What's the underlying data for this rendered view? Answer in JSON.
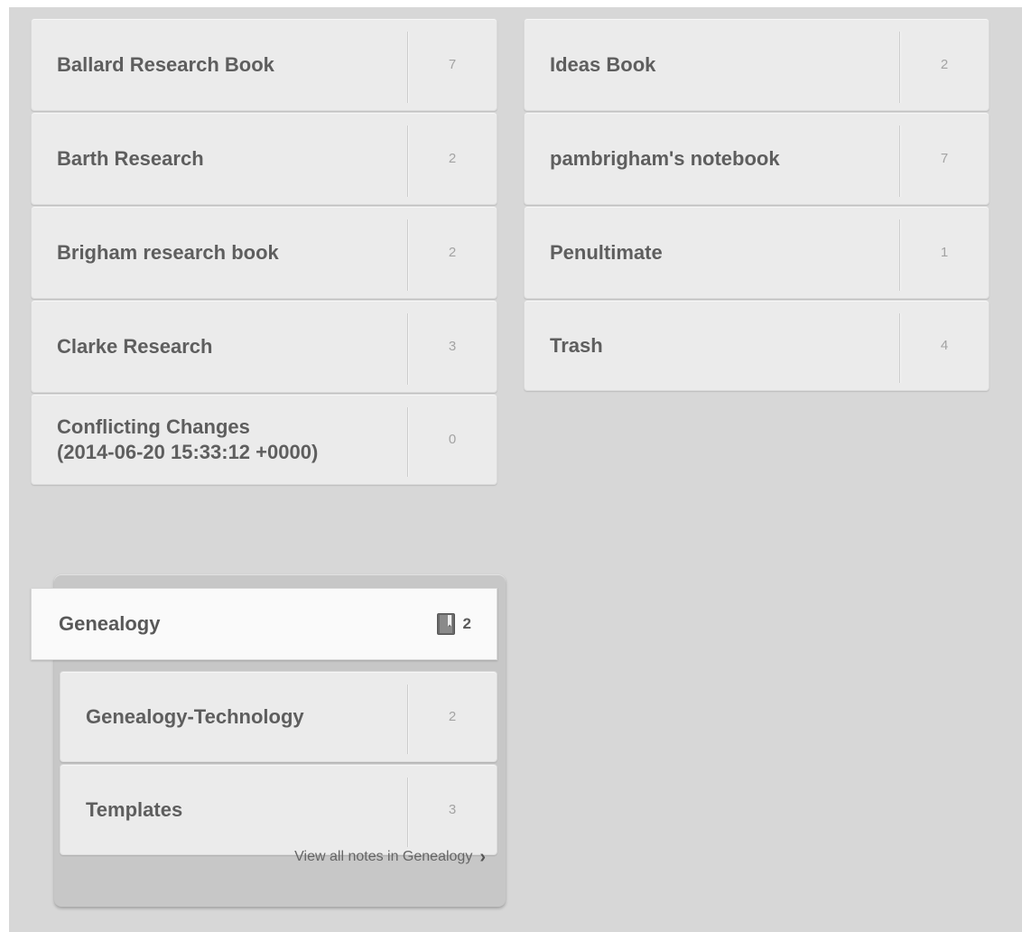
{
  "notebooks_left": [
    {
      "name": "Ballard Research Book",
      "count": "7"
    },
    {
      "name": "Barth Research",
      "count": "2"
    },
    {
      "name": "Brigham research book",
      "count": "2"
    },
    {
      "name": "Clarke Research",
      "count": "3"
    },
    {
      "name": "Conflicting Changes\n(2014-06-20 15:33:12 +0000)",
      "count": "0"
    }
  ],
  "notebooks_right": [
    {
      "name": "Ideas Book",
      "count": "2"
    },
    {
      "name": "pambrigham's notebook",
      "count": "7"
    },
    {
      "name": "Penultimate",
      "count": "1"
    },
    {
      "name": "Trash",
      "count": "4"
    }
  ],
  "stack": {
    "name": "Genealogy",
    "icon": "notebook-stack-icon",
    "count": "2",
    "notebooks": [
      {
        "name": "Genealogy-Technology",
        "count": "2"
      },
      {
        "name": "Templates",
        "count": "3"
      }
    ],
    "view_all_label": "View all notes in Genealogy",
    "view_all_chevron": "›"
  }
}
